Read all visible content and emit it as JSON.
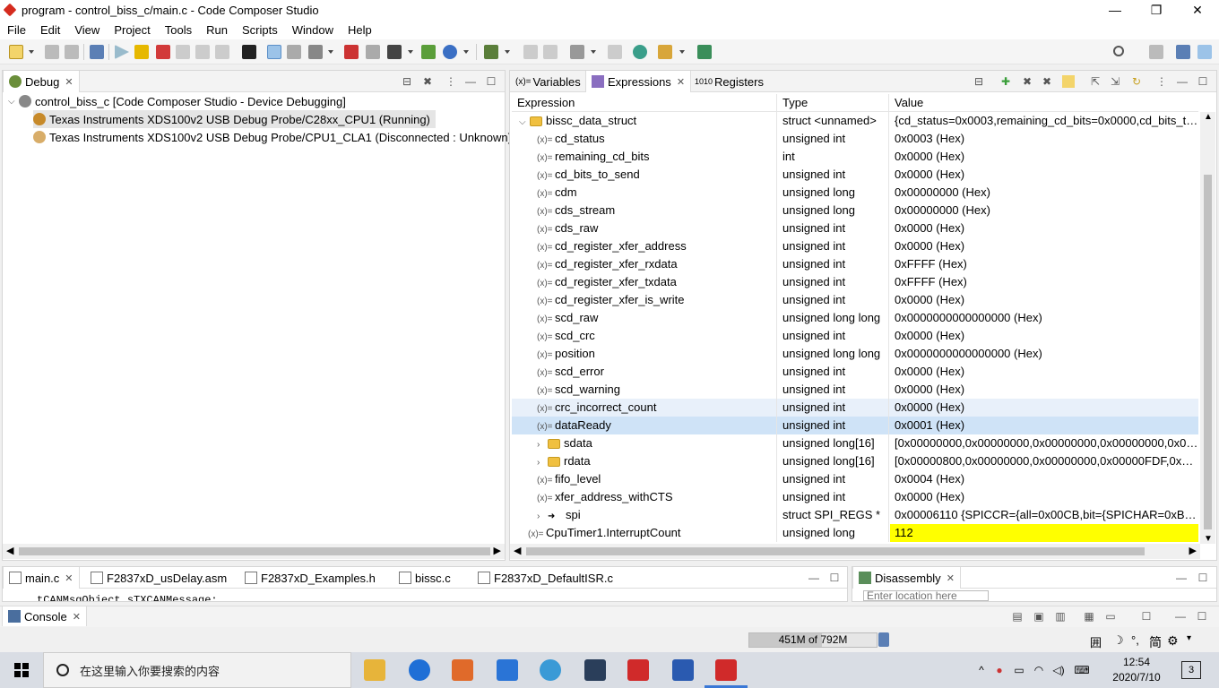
{
  "window": {
    "title": "program - control_biss_c/main.c - Code Composer Studio",
    "minimize": "—",
    "maximize": "❐",
    "close": "✕"
  },
  "menu": [
    "File",
    "Edit",
    "View",
    "Project",
    "Tools",
    "Run",
    "Scripts",
    "Window",
    "Help"
  ],
  "debug_view": {
    "tab_label": "Debug",
    "items": [
      {
        "label": "control_biss_c [Code Composer Studio - Device Debugging]"
      },
      {
        "label": "Texas Instruments XDS100v2 USB Debug Probe/C28xx_CPU1 (Running)"
      },
      {
        "label": "Texas Instruments XDS100v2 USB Debug Probe/CPU1_CLA1 (Disconnected : Unknown)"
      }
    ]
  },
  "expressions_view": {
    "tabs": [
      {
        "label": "Variables",
        "icon": "variable-icon"
      },
      {
        "label": "Expressions",
        "icon": "expressions-icon"
      },
      {
        "label": "Registers",
        "icon": "registers-icon"
      }
    ],
    "columns": [
      "Expression",
      "Type",
      "Value"
    ],
    "rows": [
      {
        "expr": "bissc_data_struct",
        "type": "struct <unnamed>",
        "value": "{cd_status=0x0003,remaining_cd_bits=0x0000,cd_bits_to_...",
        "kind": "struct-open"
      },
      {
        "expr": "cd_status",
        "type": "unsigned int",
        "value": "0x0003 (Hex)",
        "kind": "var"
      },
      {
        "expr": "remaining_cd_bits",
        "type": "int",
        "value": "0x0000 (Hex)",
        "kind": "var"
      },
      {
        "expr": "cd_bits_to_send",
        "type": "unsigned int",
        "value": "0x0000 (Hex)",
        "kind": "var"
      },
      {
        "expr": "cdm",
        "type": "unsigned long",
        "value": "0x00000000 (Hex)",
        "kind": "var"
      },
      {
        "expr": "cds_stream",
        "type": "unsigned long",
        "value": "0x00000000 (Hex)",
        "kind": "var"
      },
      {
        "expr": "cds_raw",
        "type": "unsigned int",
        "value": "0x0000 (Hex)",
        "kind": "var"
      },
      {
        "expr": "cd_register_xfer_address",
        "type": "unsigned int",
        "value": "0x0000 (Hex)",
        "kind": "var"
      },
      {
        "expr": "cd_register_xfer_rxdata",
        "type": "unsigned int",
        "value": "0xFFFF (Hex)",
        "kind": "var"
      },
      {
        "expr": "cd_register_xfer_txdata",
        "type": "unsigned int",
        "value": "0xFFFF (Hex)",
        "kind": "var"
      },
      {
        "expr": "cd_register_xfer_is_write",
        "type": "unsigned int",
        "value": "0x0000 (Hex)",
        "kind": "var"
      },
      {
        "expr": "scd_raw",
        "type": "unsigned long long",
        "value": "0x0000000000000000 (Hex)",
        "kind": "var"
      },
      {
        "expr": "scd_crc",
        "type": "unsigned int",
        "value": "0x0000 (Hex)",
        "kind": "var"
      },
      {
        "expr": "position",
        "type": "unsigned long long",
        "value": "0x0000000000000000 (Hex)",
        "kind": "var"
      },
      {
        "expr": "scd_error",
        "type": "unsigned int",
        "value": "0x0000 (Hex)",
        "kind": "var"
      },
      {
        "expr": "scd_warning",
        "type": "unsigned int",
        "value": "0x0000 (Hex)",
        "kind": "var"
      },
      {
        "expr": "crc_incorrect_count",
        "type": "unsigned int",
        "value": "0x0000 (Hex)",
        "kind": "var"
      },
      {
        "expr": "dataReady",
        "type": "unsigned int",
        "value": "0x0001 (Hex)",
        "kind": "var"
      },
      {
        "expr": "sdata",
        "type": "unsigned long[16]",
        "value": "[0x00000000,0x00000000,0x00000000,0x00000000,0x000...",
        "kind": "array"
      },
      {
        "expr": "rdata",
        "type": "unsigned long[16]",
        "value": "[0x00000800,0x00000000,0x00000000,0x00000FDF,0x000...",
        "kind": "array"
      },
      {
        "expr": "fifo_level",
        "type": "unsigned int",
        "value": "0x0004 (Hex)",
        "kind": "var"
      },
      {
        "expr": "xfer_address_withCTS",
        "type": "unsigned int",
        "value": "0x0000 (Hex)",
        "kind": "var"
      },
      {
        "expr": "spi",
        "type": "struct SPI_REGS *",
        "value": "0x00006110 {SPICCR={all=0x00CB,bit={SPICHAR=0xB,SPI...",
        "kind": "pointer"
      },
      {
        "expr": "CpuTimer1.InterruptCount",
        "type": "unsigned long",
        "value": "112",
        "kind": "top-var"
      }
    ],
    "value_highlight_color": "#ffff00"
  },
  "editor": {
    "tabs": [
      "main.c",
      "F2837xD_usDelay.asm",
      "F2837xD_Examples.h",
      "bissc.c",
      "F2837xD_DefaultISR.c"
    ],
    "code_line": "tCANMsgObject sTXCANMessage;"
  },
  "disassembly": {
    "tab_label": "Disassembly",
    "location_placeholder": "Enter location here"
  },
  "console": {
    "tab_label": "Console"
  },
  "status": {
    "heap_used": "451M",
    "heap_of": "of",
    "heap_total": "792M"
  },
  "taskbar": {
    "search_placeholder": "在这里输入你要搜索的内容",
    "time": "12:54",
    "date": "2020/7/10",
    "ime_label": "简",
    "notification_count": "3"
  }
}
